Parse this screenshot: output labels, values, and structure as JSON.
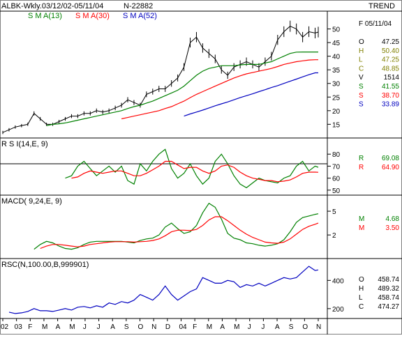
{
  "header": {
    "symbol_range": "ALBK-Wkly.03/12/02-05/11/04",
    "count": "N-22882",
    "trend_label": "TREND"
  },
  "colors": {
    "price": "#000000",
    "sma13": "#008000",
    "sma30": "#ff0000",
    "sma52": "#0000c0",
    "rsi": "#008000",
    "rsi_avg": "#ff0000",
    "macd": "#008000",
    "macd_signal": "#ff0000",
    "rsc": "#0000c0",
    "ohlc_o": "#000000",
    "ohlc_h": "#808000",
    "ohlc_l": "#808000",
    "ohlc_c": "#808000"
  },
  "price_panel": {
    "legend": [
      "S M A(13)",
      "S M A(30)",
      "S M A(52)"
    ],
    "date_label": "F 05/11/04",
    "readout": [
      {
        "k": "O",
        "v": "47.25"
      },
      {
        "k": "H",
        "v": "50.40"
      },
      {
        "k": "L",
        "v": "47.25"
      },
      {
        "k": "C",
        "v": "48.85"
      },
      {
        "k": "V",
        "v": "1514"
      },
      {
        "k": "S",
        "v": "41.55"
      },
      {
        "k": "S",
        "v": "38.70"
      },
      {
        "k": "S",
        "v": "33.89"
      }
    ]
  },
  "rsi_panel": {
    "title": "R S I(14,E, 9)",
    "readout": [
      {
        "k": "R",
        "v": "69.08"
      },
      {
        "k": "R",
        "v": "64.90"
      }
    ]
  },
  "macd_panel": {
    "title": "MACD( 9,24,E, 9)",
    "readout": [
      {
        "k": "M",
        "v": "4.68"
      },
      {
        "k": "M",
        "v": "3.50"
      }
    ]
  },
  "rsc_panel": {
    "title": "RSC(N,100.00,B,999901)",
    "readout": [
      {
        "k": "O",
        "v": "458.74"
      },
      {
        "k": "H",
        "v": "489.32"
      },
      {
        "k": "L",
        "v": "458.74"
      },
      {
        "k": "C",
        "v": "474.27"
      }
    ]
  },
  "x_labels": [
    "02",
    "03",
    "F",
    "M",
    "A",
    "M",
    "J",
    "J",
    "A",
    "S",
    "O",
    "N",
    "D",
    "04",
    "F",
    "M",
    "A",
    "M",
    "J",
    "J",
    "A",
    "S",
    "O",
    "N"
  ],
  "chart_data": [
    {
      "type": "line",
      "panel": "price",
      "x": [
        0,
        2,
        4,
        6,
        8,
        10,
        12,
        14,
        16,
        18,
        20,
        22,
        24,
        26,
        28,
        30,
        32,
        34,
        36,
        38,
        40,
        42,
        44,
        46,
        48,
        50,
        52,
        54,
        56,
        58,
        60,
        62,
        64,
        66,
        68,
        70,
        72,
        74,
        76,
        78,
        80,
        82,
        84,
        86,
        88,
        90,
        92,
        94,
        96,
        98,
        100,
        101
      ],
      "series": [
        {
          "name": "Price",
          "values": [
            12,
            13,
            14,
            14.5,
            15,
            19,
            17,
            15,
            15,
            16,
            17,
            18,
            18,
            19,
            19,
            20,
            19.5,
            20,
            21,
            22,
            24,
            23,
            22,
            26,
            27,
            28,
            28,
            30,
            32,
            36,
            45,
            47,
            43,
            41,
            39,
            35,
            33,
            36,
            37,
            38,
            37,
            36,
            38,
            40,
            46,
            49,
            51,
            50,
            47,
            49,
            48.5,
            48.85
          ]
        },
        {
          "name": "S M A(13)",
          "values": [
            null,
            null,
            null,
            null,
            null,
            null,
            null,
            14.5,
            15,
            15.2,
            15.5,
            16,
            16.5,
            17,
            17.5,
            18,
            18.5,
            19,
            19.5,
            20,
            20.8,
            21.5,
            22,
            22.8,
            23.5,
            24.5,
            25.5,
            26.5,
            27.5,
            29,
            31,
            33,
            34.5,
            35.5,
            36,
            36.5,
            36.5,
            36.5,
            36.8,
            37,
            37,
            37,
            37.5,
            38,
            39,
            40,
            41,
            41.5,
            41.55,
            41.55,
            41.55,
            41.55
          ]
        },
        {
          "name": "S M A(30)",
          "values": [
            null,
            null,
            null,
            null,
            null,
            null,
            null,
            null,
            null,
            null,
            null,
            null,
            null,
            null,
            null,
            null,
            null,
            null,
            null,
            17,
            17.5,
            18,
            18.5,
            19,
            19.5,
            20,
            20.8,
            21.5,
            22.5,
            23.5,
            24.8,
            26,
            27,
            28,
            29,
            30,
            31,
            32,
            32.8,
            33.5,
            34,
            34.5,
            35,
            35.5,
            36.2,
            37,
            37.5,
            38,
            38.3,
            38.6,
            38.7,
            38.7
          ]
        },
        {
          "name": "S M A(52)",
          "values": [
            null,
            null,
            null,
            null,
            null,
            null,
            null,
            null,
            null,
            null,
            null,
            null,
            null,
            null,
            null,
            null,
            null,
            null,
            null,
            null,
            null,
            null,
            null,
            null,
            null,
            null,
            null,
            null,
            null,
            18,
            18.8,
            19.5,
            20.2,
            21,
            21.8,
            22.5,
            23.2,
            24,
            24.8,
            25.5,
            26.2,
            27,
            27.7,
            28.5,
            29.2,
            30,
            30.8,
            31.6,
            32.4,
            33.2,
            33.89,
            33.89
          ]
        }
      ],
      "ylim": [
        11,
        55
      ],
      "yticks": [
        15,
        20,
        25,
        30,
        35,
        40,
        45,
        50
      ]
    },
    {
      "type": "line",
      "panel": "rsi",
      "x": [
        0,
        2,
        4,
        6,
        8,
        10,
        12,
        14,
        16,
        18,
        20,
        22,
        24,
        26,
        28,
        30,
        32,
        34,
        36,
        38,
        40,
        42,
        44,
        46,
        48,
        50,
        52,
        54,
        56,
        58,
        60,
        62,
        64,
        66,
        68,
        70,
        72,
        74,
        76,
        78,
        80,
        82,
        84,
        86,
        88,
        90,
        92,
        94,
        96,
        98,
        100,
        101
      ],
      "series": [
        {
          "name": "RSI",
          "values": [
            null,
            null,
            null,
            null,
            null,
            null,
            null,
            null,
            null,
            null,
            60,
            62,
            70,
            74,
            68,
            62,
            66,
            70,
            65,
            70,
            58,
            55,
            72,
            66,
            74,
            80,
            84,
            68,
            60,
            64,
            72,
            62,
            55,
            60,
            74,
            80,
            72,
            62,
            55,
            52,
            56,
            60,
            58,
            57,
            56,
            60,
            62,
            70,
            74,
            66,
            70,
            69.08
          ]
        },
        {
          "name": "Avg",
          "values": [
            null,
            null,
            null,
            null,
            null,
            null,
            null,
            null,
            null,
            null,
            null,
            60,
            61,
            64,
            66,
            65,
            64,
            65,
            66,
            66,
            64,
            62,
            62,
            64,
            67,
            70,
            74,
            74,
            71,
            68,
            69,
            69,
            66,
            64,
            66,
            70,
            71,
            69,
            65,
            62,
            60,
            59,
            58,
            58,
            57,
            57.5,
            58.5,
            61,
            64,
            65,
            65,
            64.9
          ]
        }
      ],
      "ylim": [
        47,
        90
      ],
      "yticks": [
        50,
        60,
        70,
        80
      ],
      "reference_value": 72
    },
    {
      "type": "line",
      "panel": "macd",
      "x": [
        0,
        2,
        4,
        6,
        8,
        10,
        12,
        14,
        16,
        18,
        20,
        22,
        24,
        26,
        28,
        30,
        32,
        34,
        36,
        38,
        40,
        42,
        44,
        46,
        48,
        50,
        52,
        54,
        56,
        58,
        60,
        62,
        64,
        66,
        68,
        70,
        72,
        74,
        76,
        78,
        80,
        82,
        84,
        86,
        88,
        90,
        92,
        94,
        96,
        98,
        100,
        101
      ],
      "series": [
        {
          "name": "MACD",
          "values": [
            null,
            null,
            null,
            null,
            null,
            0.2,
            0.8,
            1.2,
            1.0,
            0.6,
            0.3,
            0.2,
            0.4,
            0.8,
            1.1,
            1.2,
            1.2,
            1.2,
            1.2,
            1.2,
            1.1,
            1.0,
            1.3,
            1.5,
            1.6,
            2.0,
            3.0,
            3.5,
            2.8,
            2.2,
            2.4,
            3.2,
            4.8,
            6.0,
            5.5,
            4.0,
            2.2,
            1.6,
            1.4,
            1.0,
            0.9,
            0.7,
            0.6,
            0.7,
            0.9,
            1.4,
            2.4,
            3.6,
            4.2,
            4.4,
            4.6,
            4.68
          ]
        },
        {
          "name": "Signal",
          "values": [
            null,
            null,
            null,
            null,
            null,
            null,
            0.3,
            0.6,
            0.8,
            0.8,
            0.7,
            0.6,
            0.5,
            0.6,
            0.8,
            0.9,
            1.0,
            1.1,
            1.15,
            1.15,
            1.15,
            1.1,
            1.15,
            1.2,
            1.3,
            1.5,
            1.9,
            2.4,
            2.6,
            2.6,
            2.55,
            2.7,
            3.2,
            3.9,
            4.3,
            4.3,
            3.8,
            3.2,
            2.6,
            2.1,
            1.7,
            1.4,
            1.1,
            1.0,
            0.95,
            1.1,
            1.5,
            2.1,
            2.7,
            3.1,
            3.35,
            3.5
          ]
        }
      ],
      "ylim": [
        -0.8,
        6.5
      ],
      "yticks": [
        2,
        5
      ]
    },
    {
      "type": "line",
      "panel": "rsc",
      "x": [
        0,
        2,
        4,
        6,
        8,
        10,
        12,
        14,
        16,
        18,
        20,
        22,
        24,
        26,
        28,
        30,
        32,
        34,
        36,
        38,
        40,
        42,
        44,
        46,
        48,
        50,
        52,
        54,
        56,
        58,
        60,
        62,
        64,
        66,
        68,
        70,
        72,
        74,
        76,
        78,
        80,
        82,
        84,
        86,
        88,
        90,
        92,
        94,
        96,
        98,
        100,
        101
      ],
      "series": [
        {
          "name": "RSC",
          "values": [
            null,
            175,
            165,
            170,
            180,
            200,
            185,
            185,
            180,
            190,
            200,
            190,
            210,
            215,
            205,
            220,
            210,
            240,
            230,
            250,
            240,
            260,
            300,
            280,
            260,
            300,
            360,
            300,
            260,
            290,
            320,
            340,
            420,
            400,
            380,
            380,
            400,
            390,
            350,
            370,
            360,
            380,
            360,
            380,
            400,
            420,
            410,
            420,
            460,
            500,
            470,
            474.27
          ]
        }
      ],
      "ylim": [
        140,
        520
      ],
      "yticks": [
        200,
        400
      ]
    }
  ]
}
